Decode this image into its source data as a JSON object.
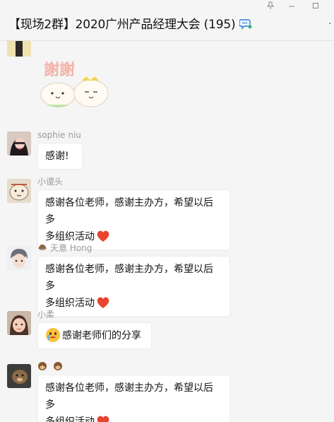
{
  "window": {
    "title": "【现场2群】2020广州产品经理大会 (195)",
    "pin_icon": "pin-icon",
    "minimize_icon": "minimize-icon",
    "maximize_icon": "maximize-icon",
    "more_icon": "more-icon"
  },
  "sticker": {
    "text": "謝謝"
  },
  "messages": [
    {
      "sender": "sophie niu",
      "line1": "感谢!",
      "line2": ""
    },
    {
      "sender": "小谡头",
      "line1": "感谢各位老师，感谢主办方，希望以后多",
      "line2": "多组织活动"
    },
    {
      "sender": "天意 Hong",
      "line1": "感谢各位老师，感谢主办方，希望以后多",
      "line2": "多组织活动"
    },
    {
      "sender": "小柔",
      "line1": "感谢老师们的分享",
      "line2": ""
    },
    {
      "sender": "",
      "line1": "感谢各位老师，感谢主办方，希望以后多",
      "line2": "多组织活动"
    }
  ],
  "colors": {
    "background": "#f5f5f5",
    "bubble": "#ffffff",
    "sender_name": "#9a9a9a",
    "heart": "#e8442e"
  }
}
